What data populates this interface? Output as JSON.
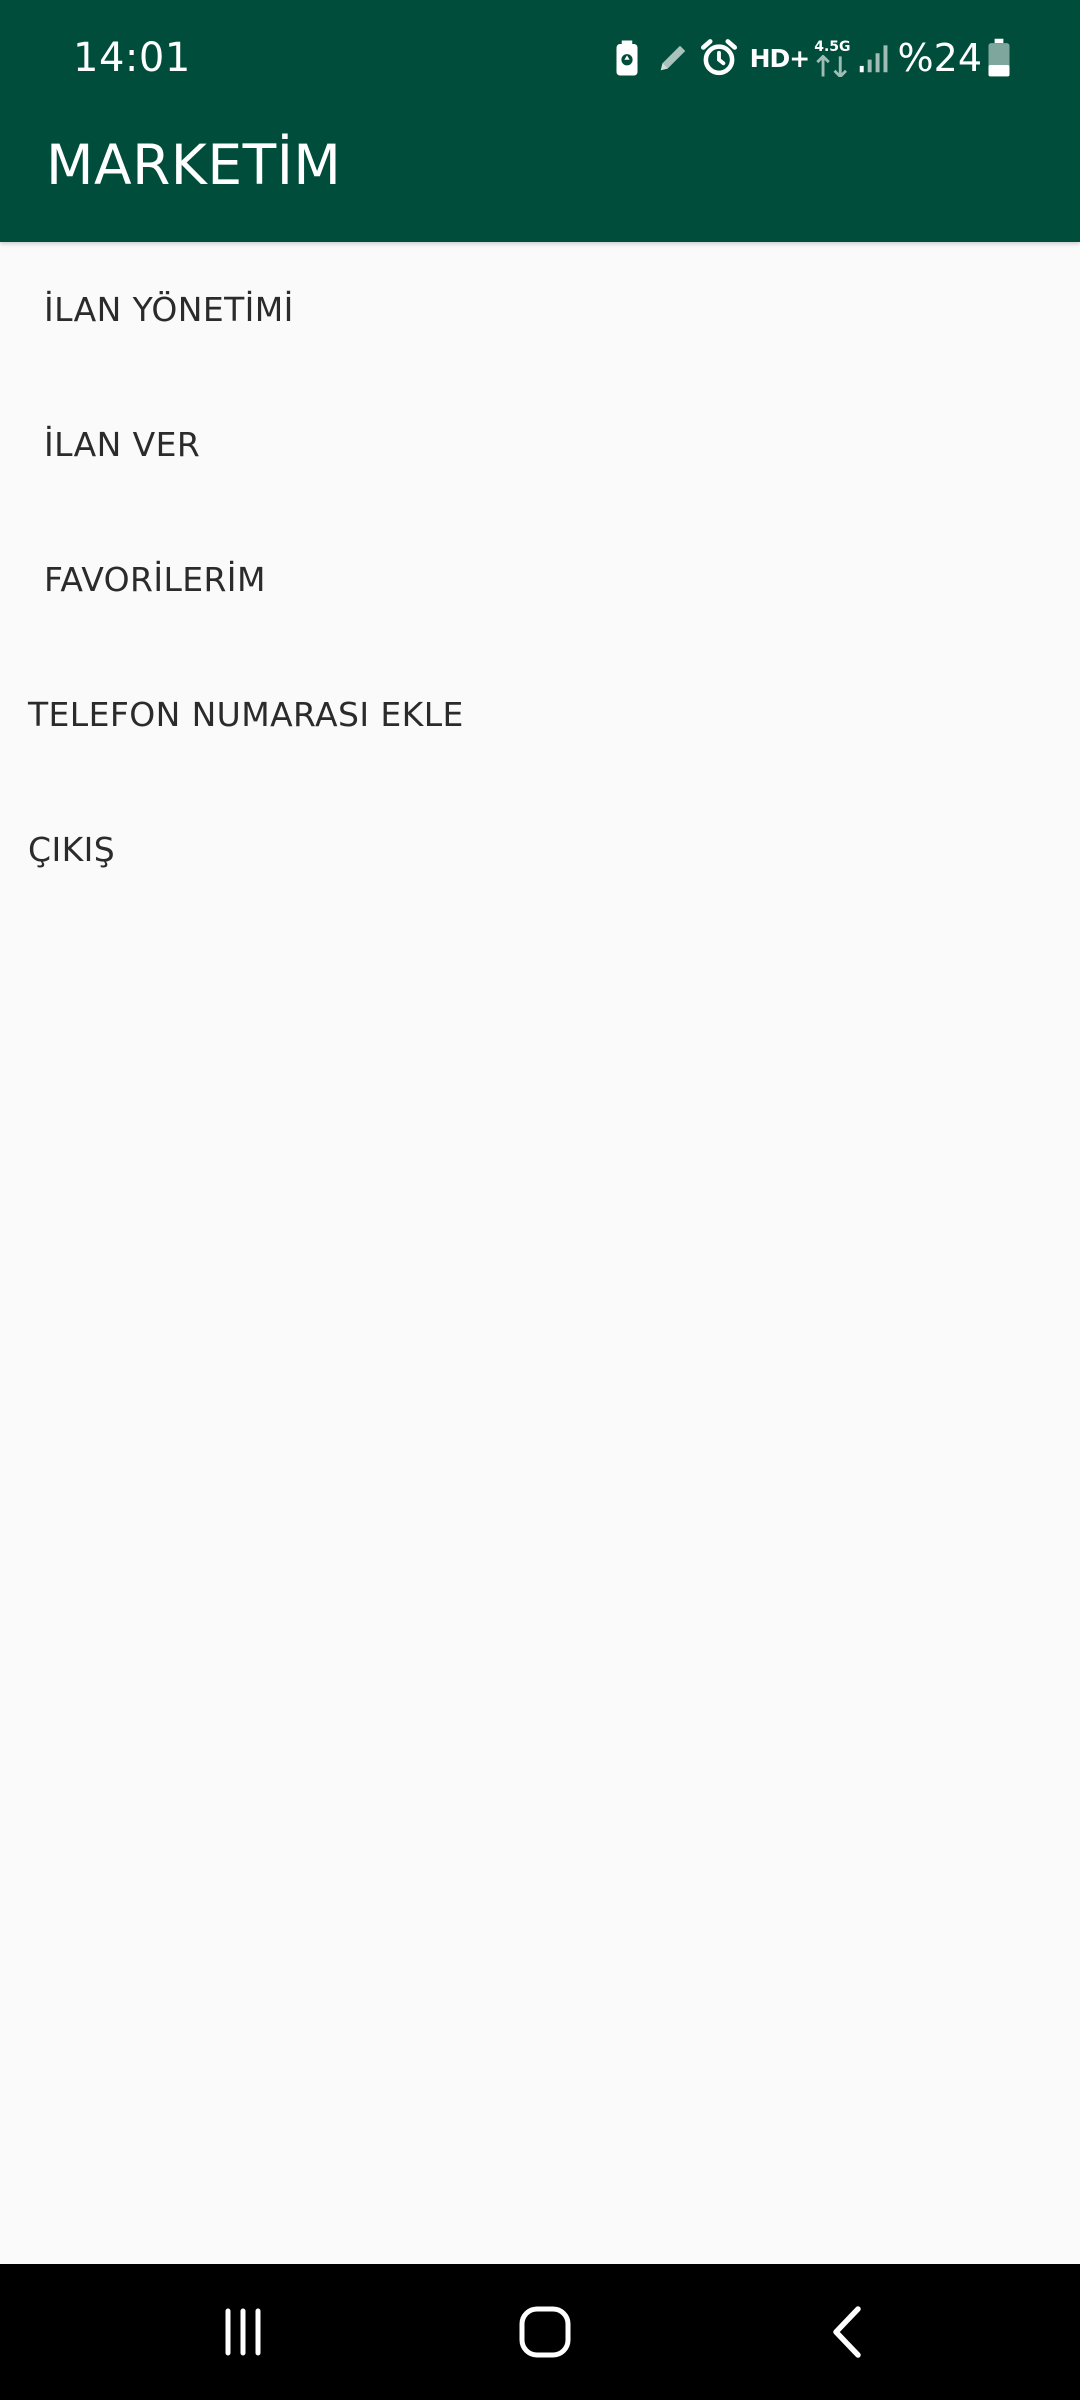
{
  "status_bar": {
    "time": "14:01",
    "network_badge": "HD+",
    "network_type": "4.5G",
    "battery_percent": "%24",
    "icons": [
      "battery-saver-icon",
      "pen-icon",
      "alarm-icon",
      "hd-voice-icon",
      "data-arrows-icon",
      "signal-icon",
      "battery-icon"
    ]
  },
  "header": {
    "title": "MARKETİM",
    "color": "#004d3c"
  },
  "menu": {
    "items": [
      {
        "label": "İLAN YÖNETİMİ"
      },
      {
        "label": "İLAN VER"
      },
      {
        "label": "FAVORİLERİM"
      },
      {
        "label": "TELEFON NUMARASI EKLE"
      },
      {
        "label": "ÇIKIŞ"
      }
    ]
  },
  "nav_bar": {
    "buttons": [
      "recent-apps-icon",
      "home-icon",
      "back-icon"
    ]
  }
}
